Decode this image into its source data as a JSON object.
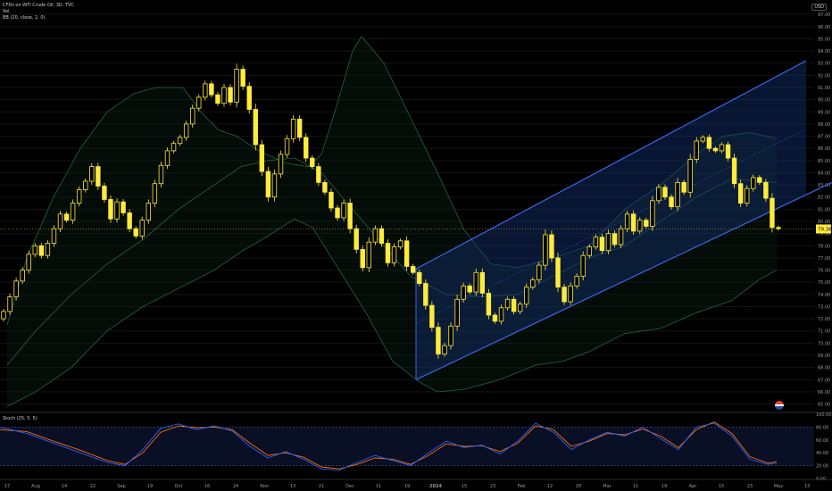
{
  "header": {
    "symbol_line": "CFDs on WTI Crude Oil, 3D, TVC",
    "vol_label": "Vol",
    "bb_label": "BB (20, close, 2, 0)",
    "currency": "USD"
  },
  "stoch": {
    "label": "Stoch (25, 5, 5)"
  },
  "colors": {
    "candle": "#ffeb3b",
    "band": "#1f5a3f",
    "channel_line": "#3a66e6",
    "channel_fill": "#143070",
    "stoch_k": "#2962ff",
    "stoch_d": "#ff6d00",
    "price_label_bg": "#ffeb3b"
  },
  "chart_data": {
    "type": "candlestick",
    "price_axis": {
      "labels": [
        "97.00",
        "96.00",
        "95.00",
        "94.00",
        "93.00",
        "92.00",
        "91.00",
        "90.00",
        "89.00",
        "88.00",
        "87.00",
        "86.00",
        "85.00",
        "84.00",
        "83.00",
        "82.00",
        "81.00",
        "80.00",
        "79.00",
        "78.00",
        "77.00",
        "76.00",
        "75.00",
        "74.00",
        "73.00",
        "72.00",
        "71.00",
        "70.00",
        "69.00",
        "68.00",
        "67.00",
        "66.00",
        "65.00"
      ],
      "ylim": [
        64.6,
        97.6
      ],
      "current_price": "79.38"
    },
    "time_axis": [
      "17",
      "Aug",
      "14",
      "22",
      "Sep",
      "19",
      "Oct",
      "16",
      "24",
      "Nov",
      "13",
      "21",
      "Dec",
      "11",
      "19",
      "2024",
      "15",
      "23",
      "Feb",
      "12",
      "20",
      "Mar",
      "11",
      "19",
      "Apr",
      "15",
      "23",
      "May",
      "13"
    ],
    "closes": [
      72.6,
      73.8,
      75.1,
      76.0,
      77.3,
      78.0,
      77.2,
      78.2,
      79.4,
      80.6,
      80.1,
      81.5,
      82.6,
      83.3,
      84.5,
      82.9,
      81.8,
      80.2,
      81.6,
      80.7,
      79.4,
      78.8,
      80.1,
      81.5,
      83.1,
      84.6,
      85.8,
      86.4,
      86.9,
      88.0,
      89.3,
      90.2,
      91.3,
      90.4,
      89.7,
      91.0,
      89.8,
      92.5,
      91.1,
      89.2,
      86.3,
      84.1,
      82.0,
      83.9,
      85.5,
      86.8,
      88.4,
      86.9,
      85.2,
      84.5,
      83.2,
      82.4,
      81.1,
      80.3,
      81.5,
      79.4,
      77.7,
      76.2,
      78.3,
      79.4,
      78.2,
      76.6,
      77.9,
      78.4,
      76.3,
      75.8,
      74.9,
      73.1,
      71.3,
      69.1,
      69.8,
      71.4,
      73.6,
      74.7,
      74.2,
      75.8,
      74.1,
      72.3,
      71.8,
      72.9,
      73.6,
      72.6,
      73.2,
      74.6,
      75.2,
      76.4,
      78.9,
      77.0,
      74.6,
      73.4,
      74.7,
      75.5,
      77.2,
      77.9,
      78.7,
      77.6,
      79.0,
      78.1,
      79.4,
      80.6,
      79.2,
      80.1,
      79.6,
      81.7,
      82.8,
      82.0,
      81.2,
      83.2,
      82.4,
      85.1,
      86.6,
      86.9,
      86.0,
      85.8,
      86.3,
      85.2,
      83.1,
      81.5,
      82.7,
      83.6,
      83.2,
      81.9,
      79.5,
      79.4
    ],
    "bollinger": {
      "upper": [
        [
          8,
          71.5
        ],
        [
          30,
          77
        ],
        [
          60,
          82
        ],
        [
          90,
          86
        ],
        [
          120,
          89
        ],
        [
          150,
          90.5
        ],
        [
          175,
          91
        ],
        [
          205,
          91
        ],
        [
          225,
          89
        ],
        [
          245,
          87.5
        ],
        [
          265,
          87
        ],
        [
          290,
          85.8
        ],
        [
          320,
          84.8
        ],
        [
          345,
          84.5
        ],
        [
          360,
          85.5
        ],
        [
          375,
          89
        ],
        [
          395,
          94
        ],
        [
          405,
          95.2
        ],
        [
          430,
          93
        ],
        [
          460,
          88.5
        ],
        [
          490,
          84
        ],
        [
          520,
          79.3
        ],
        [
          550,
          76.5
        ],
        [
          580,
          76.2
        ],
        [
          620,
          77
        ],
        [
          660,
          78
        ],
        [
          700,
          81
        ],
        [
          740,
          83
        ],
        [
          780,
          85.5
        ],
        [
          810,
          87
        ],
        [
          840,
          87.3
        ],
        [
          870,
          86.8
        ]
      ],
      "basis": [
        [
          8,
          68.2
        ],
        [
          40,
          71
        ],
        [
          80,
          74
        ],
        [
          120,
          76.5
        ],
        [
          160,
          78.5
        ],
        [
          200,
          81
        ],
        [
          240,
          83
        ],
        [
          270,
          84.5
        ],
        [
          300,
          85
        ],
        [
          330,
          85.2
        ],
        [
          360,
          84
        ],
        [
          395,
          81
        ],
        [
          430,
          78
        ],
        [
          460,
          75.5
        ],
        [
          500,
          74
        ],
        [
          540,
          73.8
        ],
        [
          580,
          74
        ],
        [
          620,
          75.5
        ],
        [
          660,
          77
        ],
        [
          700,
          78
        ],
        [
          740,
          80
        ],
        [
          780,
          82
        ],
        [
          820,
          83.5
        ],
        [
          870,
          83.2
        ]
      ],
      "lower": [
        [
          8,
          64.8
        ],
        [
          40,
          66
        ],
        [
          80,
          68
        ],
        [
          120,
          71
        ],
        [
          160,
          73
        ],
        [
          200,
          74.5
        ],
        [
          240,
          76
        ],
        [
          270,
          77.5
        ],
        [
          300,
          78.8
        ],
        [
          330,
          80.2
        ],
        [
          350,
          79.5
        ],
        [
          380,
          76
        ],
        [
          410,
          72.5
        ],
        [
          440,
          68.5
        ],
        [
          470,
          66.8
        ],
        [
          490,
          66
        ],
        [
          520,
          66.2
        ],
        [
          560,
          67
        ],
        [
          600,
          68.2
        ],
        [
          630,
          68.5
        ],
        [
          660,
          69.3
        ],
        [
          700,
          70.8
        ],
        [
          740,
          71.2
        ],
        [
          780,
          72.5
        ],
        [
          820,
          73.5
        ],
        [
          850,
          75.2
        ],
        [
          870,
          76
        ]
      ]
    },
    "channel": {
      "lower": [
        [
          466,
          67
        ],
        [
          932,
          83.2
        ]
      ],
      "upper": [
        [
          466,
          76.1
        ],
        [
          903,
          93.2
        ]
      ],
      "midline": [
        [
          466,
          71.6
        ],
        [
          903,
          87.6
        ]
      ]
    },
    "stochastic": {
      "ylim": [
        0,
        100
      ],
      "labels": [
        "100.00",
        "80.00",
        "60.00",
        "40.00",
        "20.00",
        "0.00"
      ],
      "levels": [
        80,
        20
      ],
      "k": [
        [
          0,
          80
        ],
        [
          30,
          70
        ],
        [
          60,
          55
        ],
        [
          90,
          40
        ],
        [
          120,
          25
        ],
        [
          140,
          20
        ],
        [
          160,
          45
        ],
        [
          180,
          78
        ],
        [
          200,
          85
        ],
        [
          220,
          76
        ],
        [
          240,
          82
        ],
        [
          260,
          74
        ],
        [
          280,
          50
        ],
        [
          300,
          32
        ],
        [
          320,
          42
        ],
        [
          340,
          30
        ],
        [
          360,
          15
        ],
        [
          380,
          13
        ],
        [
          400,
          25
        ],
        [
          420,
          36
        ],
        [
          440,
          28
        ],
        [
          460,
          20
        ],
        [
          480,
          40
        ],
        [
          500,
          58
        ],
        [
          520,
          48
        ],
        [
          540,
          52
        ],
        [
          560,
          38
        ],
        [
          580,
          58
        ],
        [
          600,
          86
        ],
        [
          620,
          72
        ],
        [
          640,
          45
        ],
        [
          660,
          60
        ],
        [
          680,
          72
        ],
        [
          700,
          66
        ],
        [
          720,
          80
        ],
        [
          740,
          62
        ],
        [
          760,
          45
        ],
        [
          780,
          80
        ],
        [
          800,
          86
        ],
        [
          820,
          66
        ],
        [
          840,
          30
        ],
        [
          860,
          22
        ],
        [
          870,
          24
        ]
      ],
      "d": [
        [
          0,
          76
        ],
        [
          30,
          73
        ],
        [
          60,
          58
        ],
        [
          90,
          44
        ],
        [
          120,
          28
        ],
        [
          140,
          22
        ],
        [
          160,
          40
        ],
        [
          180,
          72
        ],
        [
          200,
          82
        ],
        [
          220,
          79
        ],
        [
          240,
          80
        ],
        [
          260,
          76
        ],
        [
          280,
          55
        ],
        [
          300,
          36
        ],
        [
          320,
          40
        ],
        [
          340,
          33
        ],
        [
          360,
          18
        ],
        [
          380,
          15
        ],
        [
          400,
          22
        ],
        [
          420,
          32
        ],
        [
          440,
          30
        ],
        [
          460,
          22
        ],
        [
          480,
          36
        ],
        [
          500,
          54
        ],
        [
          520,
          50
        ],
        [
          540,
          51
        ],
        [
          560,
          42
        ],
        [
          580,
          55
        ],
        [
          600,
          82
        ],
        [
          620,
          76
        ],
        [
          640,
          50
        ],
        [
          660,
          58
        ],
        [
          680,
          70
        ],
        [
          700,
          68
        ],
        [
          720,
          77
        ],
        [
          740,
          66
        ],
        [
          760,
          48
        ],
        [
          780,
          76
        ],
        [
          800,
          88
        ],
        [
          820,
          70
        ],
        [
          840,
          34
        ],
        [
          860,
          24
        ],
        [
          870,
          26
        ]
      ]
    }
  }
}
